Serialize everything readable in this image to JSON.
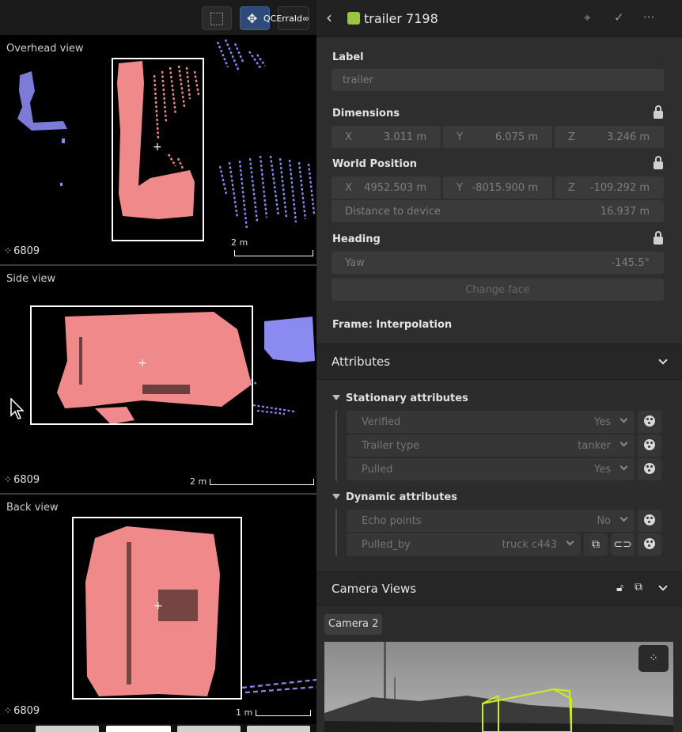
{
  "toolbar": {
    "select_tool_icon": "dotted-select-icon",
    "move_tool_icon": "move-cross-icon",
    "move_tool_label": "QCErrald∞"
  },
  "views": {
    "overhead": {
      "title": "Overhead view",
      "point_count": "6809",
      "scale_label": "2 m"
    },
    "side": {
      "title": "Side view",
      "point_count": "6809",
      "scale_label": "2 m"
    },
    "back": {
      "title": "Back view",
      "point_count": "6809",
      "scale_label": "1 m"
    }
  },
  "object": {
    "title": "trailer 7198",
    "class_color": "#9bc53d"
  },
  "label": {
    "heading": "Label",
    "placeholder": "trailer"
  },
  "dimensions": {
    "heading": "Dimensions",
    "x_key": "X",
    "x_value": "3.011 m",
    "y_key": "Y",
    "y_value": "6.075 m",
    "z_key": "Z",
    "z_value": "3.246 m"
  },
  "world_position": {
    "heading": "World Position",
    "x_key": "X",
    "x_value": "4952.503 m",
    "y_key": "Y",
    "y_value": "-8015.900 m",
    "z_key": "Z",
    "z_value": "-109.292 m",
    "distance_key": "Distance to device",
    "distance_value": "16.937 m"
  },
  "heading": {
    "heading": "Heading",
    "yaw_key": "Yaw",
    "yaw_value": "-145.5°",
    "change_face_label": "Change face"
  },
  "frame": {
    "text": "Frame: Interpolation"
  },
  "attributes": {
    "title": "Attributes",
    "stationary_title": "Stationary attributes",
    "stationary": [
      {
        "key": "Verified",
        "value": "Yes"
      },
      {
        "key": "Trailer type",
        "value": "tanker"
      },
      {
        "key": "Pulled",
        "value": "Yes"
      }
    ],
    "dynamic_title": "Dynamic attributes",
    "dynamic": [
      {
        "key": "Echo points",
        "value": "No"
      },
      {
        "key": "Pulled_by",
        "value": "truck c443"
      }
    ]
  },
  "camera_views": {
    "title": "Camera Views",
    "camera_label": "Camera 2"
  },
  "colors": {
    "object_points": "#f08a8a",
    "other_points": "#8a8af0",
    "accent": "#9bc53d",
    "active_tool": "#2c4a7a"
  }
}
